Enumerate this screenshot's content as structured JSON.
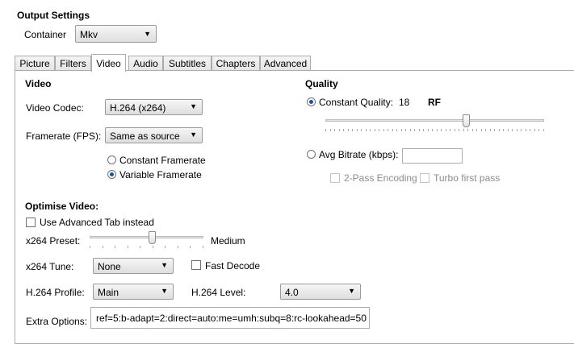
{
  "output": {
    "section_title": "Output Settings",
    "container_label": "Container",
    "container_value": "Mkv"
  },
  "tabs": [
    {
      "label": "Picture"
    },
    {
      "label": "Filters"
    },
    {
      "label": "Video"
    },
    {
      "label": "Audio"
    },
    {
      "label": "Subtitles"
    },
    {
      "label": "Chapters"
    },
    {
      "label": "Advanced"
    }
  ],
  "video": {
    "heading": "Video",
    "codec_label": "Video Codec:",
    "codec_value": "H.264 (x264)",
    "framerate_label": "Framerate (FPS):",
    "framerate_value": "Same as source",
    "constant_framerate": "Constant Framerate",
    "variable_framerate": "Variable Framerate",
    "variable_selected": true
  },
  "quality": {
    "heading": "Quality",
    "constant_quality_label": "Constant Quality:",
    "constant_quality_value": "18",
    "rf_label": "RF",
    "constant_selected": true,
    "slider_position": 0.65,
    "avg_bitrate_label": "Avg Bitrate (kbps):",
    "avg_bitrate_value": "",
    "two_pass_label": "2-Pass Encoding",
    "turbo_label": "Turbo first pass"
  },
  "optimise": {
    "heading": "Optimise Video:",
    "use_advanced_label": "Use Advanced Tab instead",
    "preset_label": "x264 Preset:",
    "preset_value": "Medium",
    "preset_slider_position": 0.55,
    "tune_label": "x264 Tune:",
    "tune_value": "None",
    "fast_decode_label": "Fast Decode",
    "profile_label": "H.264 Profile:",
    "profile_value": "Main",
    "level_label": "H.264 Level:",
    "level_value": "4.0",
    "extra_options_label": "Extra Options:",
    "extra_options_value": "ref=5:b-adapt=2:direct=auto:me=umh:subq=8:rc-lookahead=50"
  }
}
